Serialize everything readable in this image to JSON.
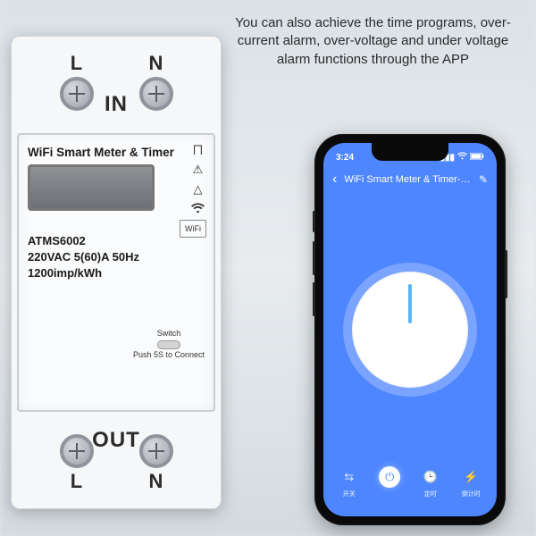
{
  "caption": "You can also achieve the time programs, over-current alarm, over-voltage and under voltage alarm functions through the APP",
  "meter": {
    "terminals": {
      "L": "L",
      "N": "N"
    },
    "in_label": "IN",
    "out_label": "OUT",
    "title": "WiFi Smart Meter & Timer",
    "wifi_chip": "WiFi",
    "model": "ATMS6002",
    "spec1": "220VAC  5(60)A  50Hz",
    "spec2": "1200imp/kWh",
    "switch_label": "Switch",
    "switch_sub": "Push 5S to Connect"
  },
  "phone": {
    "status_time": "3:24",
    "title": "WiFi Smart Meter & Timer-…",
    "controls": {
      "left": "开关",
      "power": "",
      "timer": "定时",
      "delay": "倒计时"
    }
  }
}
